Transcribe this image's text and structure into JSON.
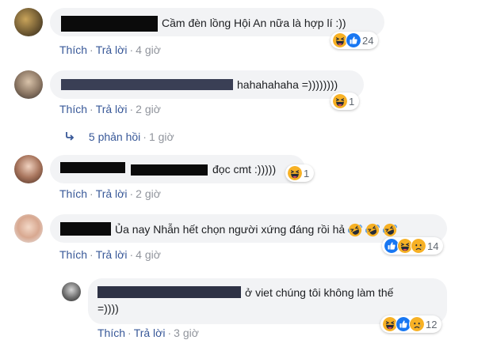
{
  "comments": [
    {
      "text": "Cầm đèn lồng Hội An nữa là hợp lí :))",
      "actions": {
        "like": "Thích",
        "reply": "Trả lời",
        "time": "4 giờ"
      },
      "reactions": {
        "icons": [
          "haha-icon",
          "like-icon"
        ],
        "count": "24"
      }
    },
    {
      "text": "hahahahaha =))))))))",
      "actions": {
        "like": "Thích",
        "reply": "Trả lời",
        "time": "2 giờ"
      },
      "reactions": {
        "icons": [
          "haha-icon"
        ],
        "count": "1"
      },
      "replies_link": {
        "label": "5 phản hồi",
        "time": "1 giờ"
      }
    },
    {
      "text": "đọc cmt :)))))",
      "actions": {
        "like": "Thích",
        "reply": "Trả lời",
        "time": "2 giờ"
      },
      "reactions": {
        "icons": [
          "haha-icon"
        ],
        "count": "1"
      }
    },
    {
      "text": "Ủa nay Nhẫn hết chọn người xứng đáng rồi hả",
      "emoji_suffix": [
        "rofl-emoji",
        "rofl-emoji",
        "rofl-emoji"
      ],
      "actions": {
        "like": "Thích",
        "reply": "Trả lời",
        "time": "4 giờ"
      },
      "reactions": {
        "icons": [
          "like-icon",
          "haha-icon",
          "sad-icon"
        ],
        "count": "14"
      }
    },
    {
      "text_line1": "ở viet chúng tôi không làm thế",
      "text_line2": "=))))",
      "actions": {
        "like": "Thích",
        "reply": "Trả lời",
        "time": "3 giờ"
      },
      "reactions": {
        "icons": [
          "haha-icon",
          "like-icon",
          "sad-icon"
        ],
        "count": "12"
      }
    }
  ],
  "colors": {
    "link": "#385898",
    "muted": "#90949c",
    "bubble": "#f2f3f5",
    "like": "#1877f2",
    "haha": "#f7b125"
  }
}
